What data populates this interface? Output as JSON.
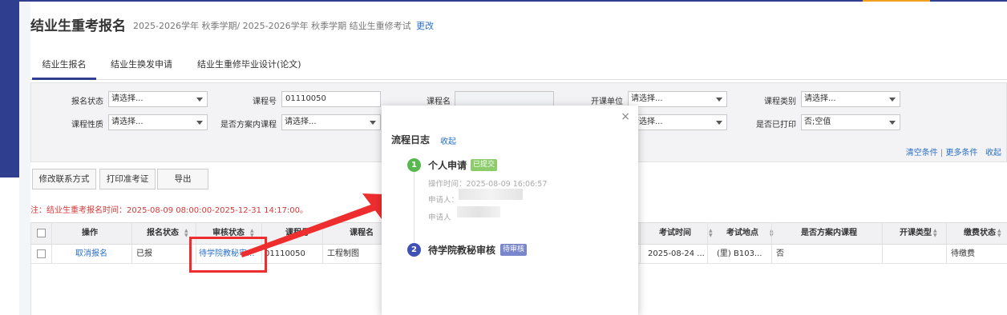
{
  "header": {
    "title": "结业生重考报名",
    "term": "2025-2026学年 秋季学期/ 2025-2026学年 秋季学期 结业生重修考试",
    "change_link": "更改"
  },
  "tabs": [
    {
      "label": "结业生报名",
      "active": true
    },
    {
      "label": "结业生换发申请",
      "active": false
    },
    {
      "label": "结业生重修毕业设计(论文)",
      "active": false
    }
  ],
  "filters": {
    "status_label": "报名状态",
    "status_value": "请选择...",
    "course_no_label": "课程号",
    "course_no_value": "01110050",
    "course_name_label": "课程名",
    "course_name_value": "",
    "dept_label": "开课单位",
    "dept_value": "请选择...",
    "category_label": "课程类别",
    "category_value": "请选择...",
    "nature_label": "课程性质",
    "nature_value": "请选择...",
    "in_plan_label": "是否方案内课程",
    "in_plan_value": "请选择...",
    "hidden_select_value": "请选择...",
    "printed_label": "是否已打印",
    "printed_value": "否;空值",
    "clear_link": "清空条件",
    "more_link": "更多条件",
    "collapse_link": "收起"
  },
  "toolbar": {
    "edit_contact": "修改联系方式",
    "print_ticket": "打印准考证",
    "export": "导出"
  },
  "notice": "注：结业生重考报名时间：2025-08-09 08:00:00-2025-12-31 14:17:00。",
  "table": {
    "headers": {
      "action": "操作",
      "enroll_status": "报名状态",
      "review_status": "审核状态",
      "course_no": "课程号",
      "course_name": "课程名",
      "exam_time": "考试时间",
      "exam_place": "考试地点",
      "in_plan": "是否方案内课程",
      "course_type": "开课类型",
      "fee_status": "缴费状态"
    },
    "row": {
      "action": "取消报名",
      "enroll_status": "已报",
      "review_status": "待学院教秘审...",
      "course_no": "01110050",
      "course_name": "工程制图",
      "exam_time": "2025-08-24 ...",
      "exam_place": "(里) B103...",
      "in_plan": "否",
      "course_type": "",
      "fee_status": "待缴费"
    }
  },
  "modal": {
    "close_symbol": "×",
    "title": "流程日志",
    "collapse_link": "收起",
    "steps": [
      {
        "number": "1",
        "name": "个人申请",
        "tag": "已提交",
        "time_label": "操作时间：2025-08-09 16:06:57",
        "applicant_label_1": "申请人：",
        "applicant_label_2": "申请人"
      },
      {
        "number": "2",
        "name": "待学院教秘审核",
        "tag": "待审核"
      }
    ]
  },
  "colors": {
    "brand": "#2f3e8f",
    "link": "#2a6fc9",
    "notice": "#d23a3a",
    "annotation": "#ee2e2e",
    "step_done": "#58b850",
    "step_pending": "#3f51b5"
  }
}
